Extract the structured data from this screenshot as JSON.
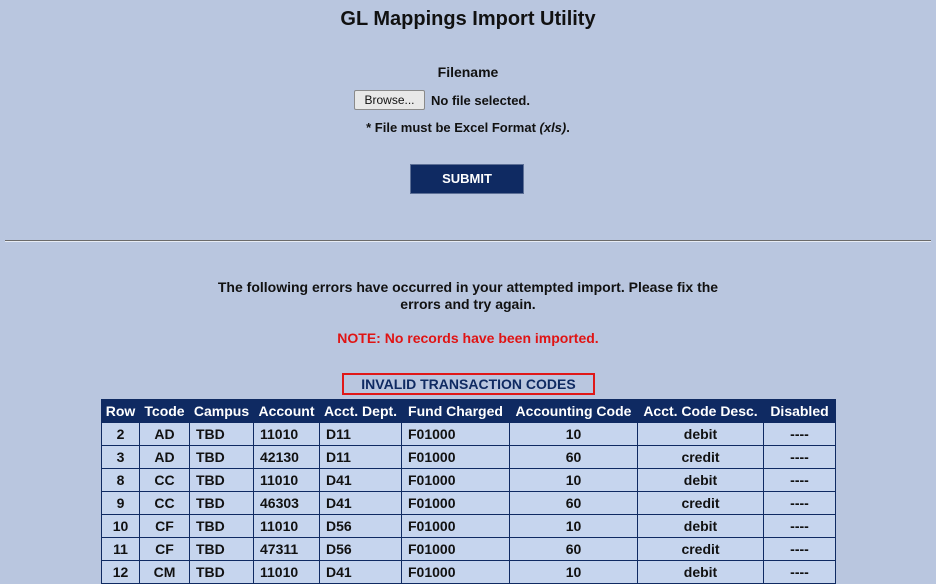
{
  "page": {
    "title": "GL Mappings Import Utility"
  },
  "upload": {
    "filename_label": "Filename",
    "browse_label": "Browse...",
    "file_status": "No file selected.",
    "format_note_prefix": "* File must be Excel Format ",
    "format_note_ext": "(xls)",
    "format_note_suffix": ".",
    "submit_label": "SUBMIT"
  },
  "result": {
    "error_message": "The following errors have occurred in your attempted import. Please fix the errors and try again.",
    "note": "NOTE: No records have been imported.",
    "section_heading": "INVALID TRANSACTION CODES"
  },
  "table": {
    "headers": [
      "Row",
      "Tcode",
      "Campus",
      "Account",
      "Acct. Dept.",
      "Fund Charged",
      "Accounting Code",
      "Acct. Code Desc.",
      "Disabled"
    ],
    "rows": [
      [
        "2",
        "AD",
        "TBD",
        "11010",
        "D11",
        "F01000",
        "10",
        "debit",
        "----"
      ],
      [
        "3",
        "AD",
        "TBD",
        "42130",
        "D11",
        "F01000",
        "60",
        "credit",
        "----"
      ],
      [
        "8",
        "CC",
        "TBD",
        "11010",
        "D41",
        "F01000",
        "10",
        "debit",
        "----"
      ],
      [
        "9",
        "CC",
        "TBD",
        "46303",
        "D41",
        "F01000",
        "60",
        "credit",
        "----"
      ],
      [
        "10",
        "CF",
        "TBD",
        "11010",
        "D56",
        "F01000",
        "10",
        "debit",
        "----"
      ],
      [
        "11",
        "CF",
        "TBD",
        "47311",
        "D56",
        "F01000",
        "60",
        "credit",
        "----"
      ],
      [
        "12",
        "CM",
        "TBD",
        "11010",
        "D41",
        "F01000",
        "10",
        "debit",
        "----"
      ]
    ]
  },
  "colors": {
    "background": "#b9c6df",
    "header_navy": "#0f2a62",
    "alert_red": "#e01414",
    "cell_bg": "#c6d5ee"
  }
}
